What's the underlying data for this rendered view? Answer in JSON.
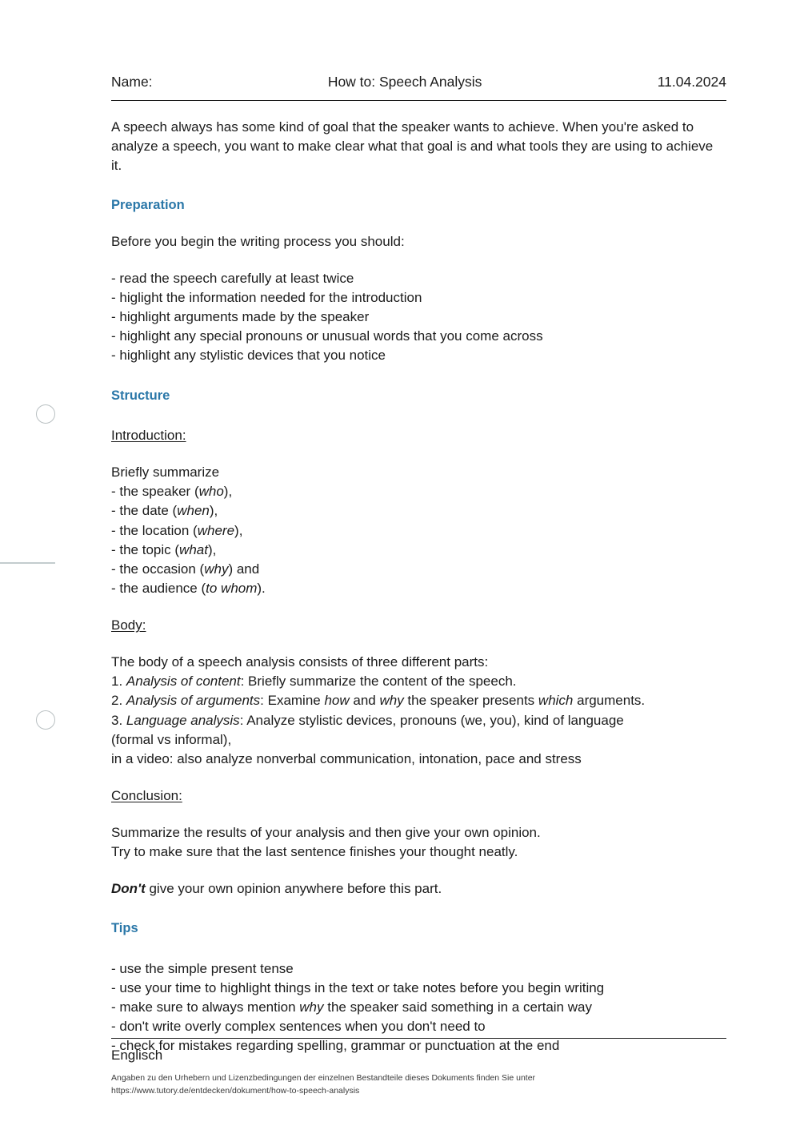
{
  "header": {
    "name_label": "Name:",
    "title": "How to: Speech Analysis",
    "date": "11.04.2024"
  },
  "intro": {
    "paragraph": "A speech always has some kind of goal that the speaker wants to achieve. When you're asked to analyze a speech, you want to make clear what that goal is and what tools they are using to achieve it."
  },
  "preparation": {
    "heading": "Preparation",
    "lead": "Before you begin the writing process you should:",
    "items": [
      "- read the speech carefully at least twice",
      "- higlight the information needed for the introduction",
      "- highlight arguments made by the speaker",
      "- highlight any special pronouns or unusual words that you come across",
      "- highlight any stylistic devices that you notice"
    ]
  },
  "structure": {
    "heading": "Structure",
    "introduction": {
      "label": "Introduction:",
      "lead": "Briefly summarize",
      "items": [
        {
          "text": "- the speaker (",
          "emphasis": "who",
          "tail": "),"
        },
        {
          "text": "- the date (",
          "emphasis": "when",
          "tail": "),"
        },
        {
          "text": "- the location (",
          "emphasis": "where",
          "tail": "),"
        },
        {
          "text": "- the topic (",
          "emphasis": "what",
          "tail": "),"
        },
        {
          "text": "- the occasion (",
          "emphasis": "why",
          "tail": ") and"
        },
        {
          "text": "- the audience (",
          "emphasis": "to whom",
          "tail": ")."
        }
      ]
    },
    "body": {
      "label": "Body:",
      "lead": "The body of a speech analysis consists of three different parts:",
      "item1_num": "1. ",
      "item1_em": "Analysis of content",
      "item1_rest": ": Briefly summarize the content of the speech.",
      "item2_num": "2. ",
      "item2_em": "Analysis of arguments",
      "item2_a": ": Examine ",
      "item2_em2": "how",
      "item2_b": " and ",
      "item2_em3": "why",
      "item2_c": " the speaker presents ",
      "item2_em4": "which",
      "item2_d": " arguments.",
      "item3_num": "3. ",
      "item3_em": "Language analysis",
      "item3_rest": ": Analyze stylistic devices, pronouns (we, you), kind of language",
      "item3_wrap": "(formal vs informal),",
      "item4": "in a video: also analyze nonverbal communication, intonation, pace and stress"
    },
    "conclusion": {
      "label": "Conclusion:",
      "line1": "Summarize the results of your analysis and then give your own opinion.",
      "line2": "Try to make sure that the last sentence finishes your thought neatly.",
      "warn_bold": "Don't",
      "warn_rest": " give your own opinion anywhere before this part."
    }
  },
  "tips": {
    "heading": "Tips",
    "items": [
      {
        "text": "- use the simple present tense"
      },
      {
        "text": "- use your time to highlight things in the text or take notes before you begin writing"
      },
      {
        "text": "- make sure to always mention ",
        "emphasis": "why",
        "tail": " the speaker said something in a certain way"
      },
      {
        "text": "- don't write overly complex sentences when you don't need to"
      },
      {
        "text": "- check for mistakes regarding spelling, grammar or punctuation at the end"
      }
    ]
  },
  "footer": {
    "subject": "Englisch",
    "note_line1": "Angaben zu den Urhebern und Lizenzbedingungen der einzelnen Bestandteile dieses Dokuments finden Sie unter",
    "note_line2": "https://www.tutory.de/entdecken/dokument/how-to-speech-analysis"
  },
  "theme": {
    "heading_color": "#2a77a8",
    "text_color": "#1b1b1b",
    "rule_color": "#1a1a1a",
    "margin_mark_color": "#b9c0c2"
  }
}
